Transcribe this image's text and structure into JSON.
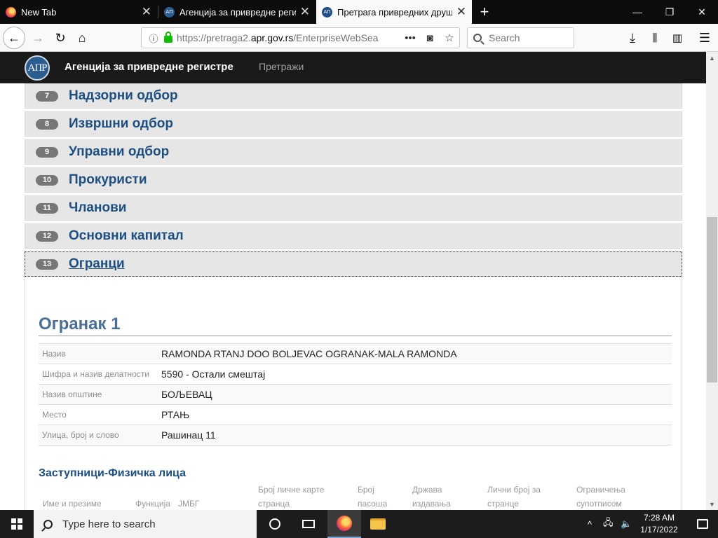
{
  "browser": {
    "tabs": [
      {
        "title": "New Tab",
        "icon": "firefox-icon",
        "active": false
      },
      {
        "title": "Агенција за привредне регистре",
        "icon": "apr-favicon",
        "active": false
      },
      {
        "title": "Претрага привредних друштава",
        "icon": "apr-favicon",
        "active": true
      }
    ],
    "url_prefix": "https://pretraga2.",
    "url_domain": "apr.gov.rs",
    "url_rest": "/EnterpriseWebSea",
    "search_placeholder": "Search"
  },
  "site": {
    "logo_text": "АПР",
    "name": "Агенција за привредне регистре",
    "nav_search": "Претражи"
  },
  "accordion": [
    {
      "num": "7",
      "label": "Надзорни одбор",
      "open": false
    },
    {
      "num": "8",
      "label": "Извршни одбор",
      "open": false
    },
    {
      "num": "9",
      "label": "Управни одбор",
      "open": false
    },
    {
      "num": "10",
      "label": "Прокуристи",
      "open": false
    },
    {
      "num": "11",
      "label": "Чланови",
      "open": false
    },
    {
      "num": "12",
      "label": "Основни капитал",
      "open": false
    },
    {
      "num": "13",
      "label": "Огранци",
      "open": true
    }
  ],
  "branch": {
    "title": "Огранак 1",
    "details": [
      {
        "key": "Назив",
        "value": "RAMONDA RTANJ DOO BOLJEVAC OGRANAK-MALA RAMONDA"
      },
      {
        "key": "Шифра и назив делатности",
        "value": "5590 - Остали смештај"
      },
      {
        "key": "Назив општине",
        "value": "БОЉЕВАЦ"
      },
      {
        "key": "Место",
        "value": "РТАЊ"
      },
      {
        "key": "Улица, број и слово",
        "value": "Рашинац 11"
      }
    ],
    "representatives_title": "Заступници-Физичка лица",
    "representatives_columns": [
      {
        "line1": "",
        "line2": "Име и презиме"
      },
      {
        "line1": "",
        "line2": "Функција"
      },
      {
        "line1": "",
        "line2": "ЈМБГ"
      },
      {
        "line1": "Број личне карте",
        "line2": "странца"
      },
      {
        "line1": "Број",
        "line2": "пасоша"
      },
      {
        "line1": "Држава",
        "line2": "издавања"
      },
      {
        "line1": "Лични број за",
        "line2": "странце"
      },
      {
        "line1": "Ограничења",
        "line2": "супотписом"
      }
    ]
  },
  "taskbar": {
    "search_placeholder": "Type here to search",
    "time": "7:28 AM",
    "date": "1/17/2022"
  }
}
